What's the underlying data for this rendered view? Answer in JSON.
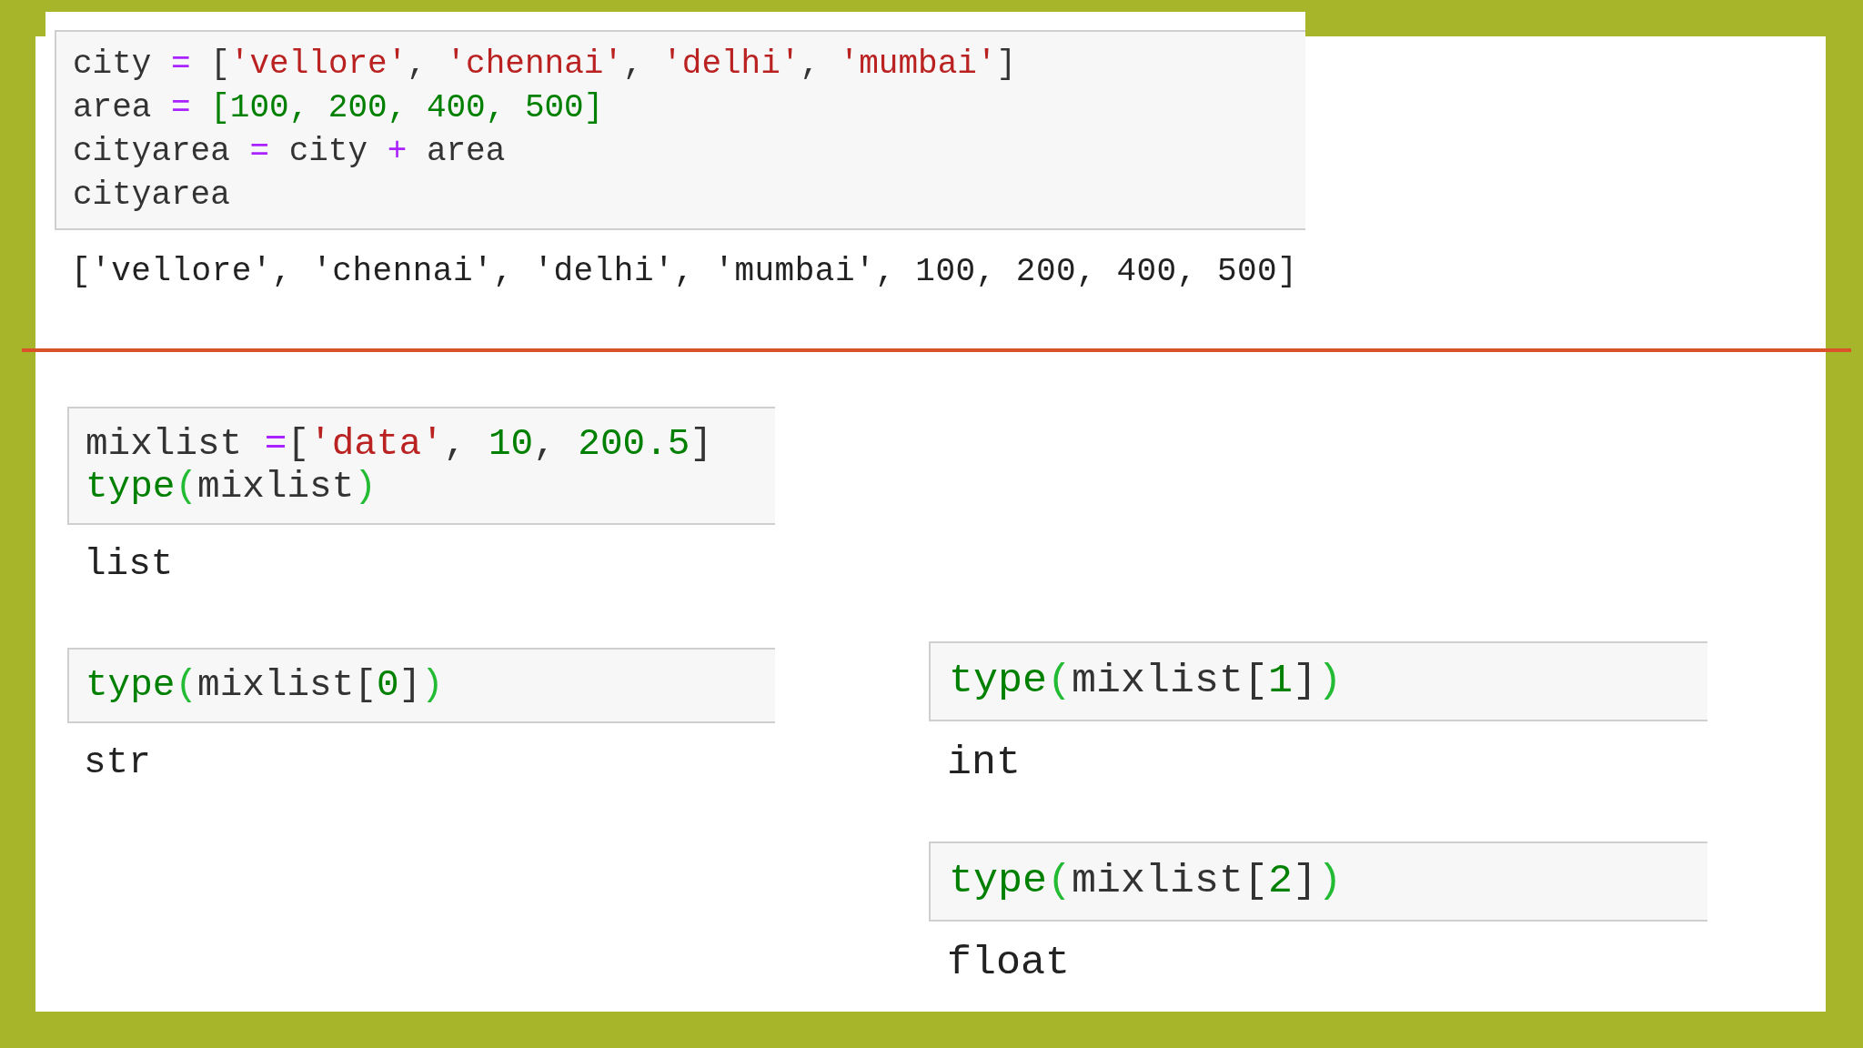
{
  "top_cell": {
    "input": [
      [
        {
          "text": "city ",
          "kind": "name"
        },
        {
          "text": "=",
          "kind": "op"
        },
        {
          "text": " [",
          "kind": "punct"
        },
        {
          "text": "'vellore'",
          "kind": "string"
        },
        {
          "text": ", ",
          "kind": "punct"
        },
        {
          "text": "'chennai'",
          "kind": "string"
        },
        {
          "text": ", ",
          "kind": "punct"
        },
        {
          "text": "'delhi'",
          "kind": "string"
        },
        {
          "text": ", ",
          "kind": "punct"
        },
        {
          "text": "'mumbai'",
          "kind": "string"
        },
        {
          "text": "]",
          "kind": "punct"
        }
      ],
      [
        {
          "text": "area ",
          "kind": "name"
        },
        {
          "text": "=",
          "kind": "op"
        },
        {
          "text": " [100, 200, 400, 500]",
          "kind": "number"
        }
      ],
      [
        {
          "text": "cityarea ",
          "kind": "name"
        },
        {
          "text": "=",
          "kind": "op"
        },
        {
          "text": " city ",
          "kind": "name"
        },
        {
          "text": "+",
          "kind": "op"
        },
        {
          "text": " area",
          "kind": "name"
        }
      ],
      [
        {
          "text": "cityarea",
          "kind": "name"
        }
      ]
    ],
    "output": "['vellore', 'chennai', 'delhi', 'mumbai', 100, 200, 400, 500]"
  },
  "left_column": [
    {
      "input": [
        [
          {
            "text": "mixlist ",
            "kind": "name"
          },
          {
            "text": "=",
            "kind": "op"
          },
          {
            "text": "[",
            "kind": "punct"
          },
          {
            "text": "'data'",
            "kind": "string"
          },
          {
            "text": ", ",
            "kind": "punct"
          },
          {
            "text": "10",
            "kind": "number"
          },
          {
            "text": ", ",
            "kind": "punct"
          },
          {
            "text": "200.5",
            "kind": "number"
          },
          {
            "text": "]",
            "kind": "punct"
          }
        ],
        [
          {
            "text": "type",
            "kind": "builtin"
          },
          {
            "text": "(",
            "kind": "paren"
          },
          {
            "text": "mixlist",
            "kind": "name"
          },
          {
            "text": ")",
            "kind": "paren"
          }
        ]
      ],
      "output": "list"
    },
    {
      "input": [
        [
          {
            "text": "type",
            "kind": "builtin"
          },
          {
            "text": "(",
            "kind": "paren"
          },
          {
            "text": "mixlist[",
            "kind": "name"
          },
          {
            "text": "0",
            "kind": "number"
          },
          {
            "text": "]",
            "kind": "name"
          },
          {
            "text": ")",
            "kind": "paren"
          }
        ]
      ],
      "output": "str"
    }
  ],
  "right_column": [
    {
      "input": [
        [
          {
            "text": "type",
            "kind": "builtin"
          },
          {
            "text": "(",
            "kind": "paren"
          },
          {
            "text": "mixlist[",
            "kind": "name"
          },
          {
            "text": "1",
            "kind": "number"
          },
          {
            "text": "]",
            "kind": "name"
          },
          {
            "text": ")",
            "kind": "paren"
          }
        ]
      ],
      "output": "int"
    },
    {
      "input": [
        [
          {
            "text": "type",
            "kind": "builtin"
          },
          {
            "text": "(",
            "kind": "paren"
          },
          {
            "text": "mixlist[",
            "kind": "name"
          },
          {
            "text": "2",
            "kind": "number"
          },
          {
            "text": "]",
            "kind": "name"
          },
          {
            "text": ")",
            "kind": "paren"
          }
        ]
      ],
      "output": "float"
    }
  ]
}
